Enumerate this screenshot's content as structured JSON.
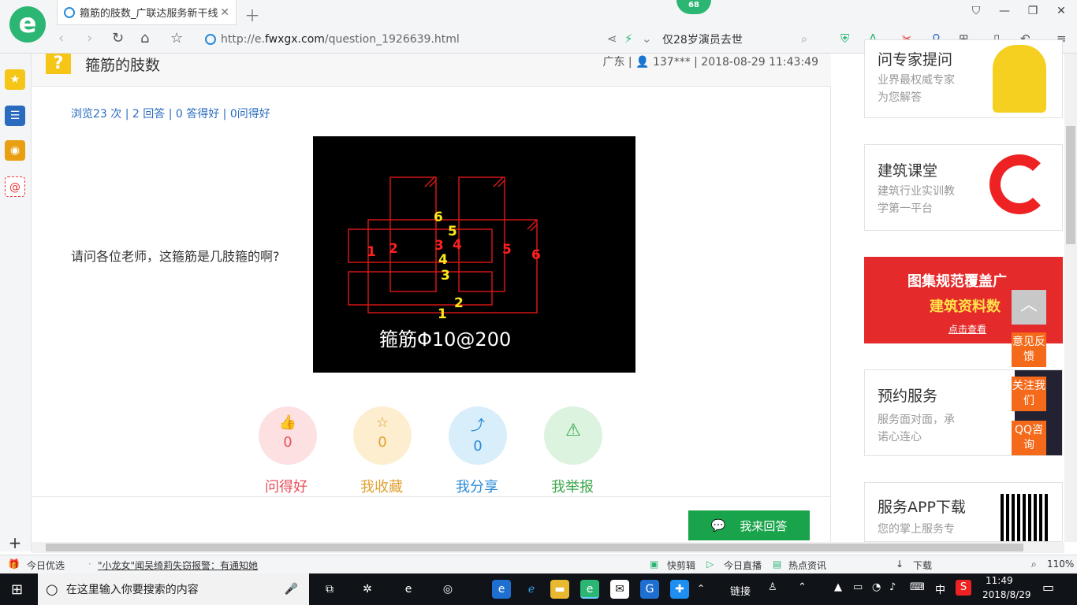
{
  "browser": {
    "tab_title": "箍筋的肢数_广联达服务新干线",
    "badge": "68",
    "url_prefix": "http://e.",
    "url_domain": "fwxgx.com",
    "url_path": "/question_1926639.html",
    "search_text": "仅28岁演员去世",
    "logo_letter": "e"
  },
  "question": {
    "title": "箍筋的肢数",
    "meta": "广东 | 👤 137*** | 2018-08-29 11:43:49",
    "stats": "浏览23 次 | 2 回答 | 0 答得好 | 0问得好",
    "body": "请问各位老师，这箍筋是几肢箍的啊?",
    "image_caption": "箍筋Φ10@200"
  },
  "cad_labels": {
    "red": [
      "1",
      "2",
      "3",
      "4",
      "5",
      "6"
    ],
    "yellow": [
      "6",
      "5",
      "4",
      "3",
      "2",
      "1"
    ]
  },
  "actions": [
    {
      "label": "问得好",
      "count": "0",
      "color": "#e8505b",
      "bg": "#fde0e2",
      "icon": "thumbs-up-icon"
    },
    {
      "label": "我收藏",
      "count": "0",
      "color": "#e0a030",
      "bg": "#fdeecf",
      "icon": "star-icon"
    },
    {
      "label": "我分享",
      "count": "0",
      "color": "#2a8ad6",
      "bg": "#d8eefb",
      "icon": "share-icon"
    },
    {
      "label": "我举报",
      "count": "",
      "color": "#3aa64a",
      "bg": "#dcf3e0",
      "icon": "warning-icon"
    }
  ],
  "answer_button": "我来回答",
  "sidebar": {
    "card1_title": "问专家提问",
    "card1_desc1": "业界最权威专家",
    "card1_desc2": "为您解答",
    "card2_title": "建筑课堂",
    "card2_desc1": "建筑行业实训教",
    "card2_desc2": "学第一平台",
    "banner_line1": "图集规范覆盖广",
    "banner_line2": "建筑资料数",
    "banner_link": "点击查看",
    "card3_title": "预约服务",
    "card3_desc1": "服务面对面，承",
    "card3_desc2": "诺心连心",
    "card4_title": "服务APP下载",
    "card4_desc": "您的掌上服务专"
  },
  "float_buttons": [
    "意见反馈",
    "关注我们",
    "QQ咨询"
  ],
  "float_top": "︿",
  "newsbar": {
    "left_label": "今日优选",
    "headline": "\"小龙女\"闻吴绮莉失窃报警：有通知她",
    "item1": "快剪辑",
    "item2": "今日直播",
    "item3": "热点资讯",
    "item4": "下载",
    "zoom": "110%"
  },
  "taskbar": {
    "search_placeholder": "在这里输入你要搜索的内容",
    "links": "链接",
    "ime": "中",
    "time": "11:49",
    "date": "2018/8/29"
  }
}
